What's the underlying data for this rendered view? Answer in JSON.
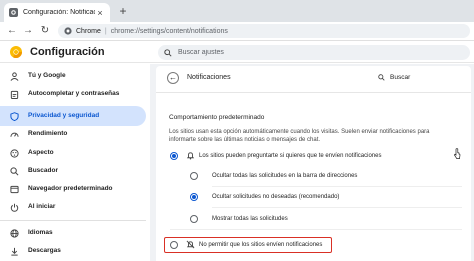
{
  "tab": {
    "title": "Configuración: Notificaciones",
    "close": "×",
    "new": "+"
  },
  "toolbar": {
    "back": "←",
    "forward": "→",
    "reload": "↻",
    "omnibox": {
      "scheme": "Chrome",
      "sep": "|",
      "path": "chrome://settings/content/notifications"
    }
  },
  "header": {
    "title": "Configuración",
    "search_placeholder": "Buscar ajustes"
  },
  "sidebar": {
    "items": [
      {
        "label": "Tú y Google",
        "icon": "person-icon",
        "active": false
      },
      {
        "label": "Autocompletar y contraseñas",
        "icon": "clipboard-icon",
        "active": false
      },
      {
        "label": "Privacidad y seguridad",
        "icon": "shield-icon",
        "active": true
      },
      {
        "label": "Rendimiento",
        "icon": "speedometer-icon",
        "active": false
      },
      {
        "label": "Aspecto",
        "icon": "palette-icon",
        "active": false
      },
      {
        "label": "Buscador",
        "icon": "search-icon",
        "active": false
      },
      {
        "label": "Navegador predeterminado",
        "icon": "browser-icon",
        "active": false
      },
      {
        "label": "Al iniciar",
        "icon": "power-icon",
        "active": false
      },
      {
        "label": "Idiomas",
        "icon": "globe-icon",
        "active": false
      },
      {
        "label": "Descargas",
        "icon": "download-icon",
        "active": false
      }
    ]
  },
  "panel": {
    "back": "←",
    "title": "Notificaciones",
    "search_label": "Buscar",
    "section_title": "Comportamiento predeterminado",
    "description": "Los sitios usan esta opción automáticamente cuando los visitas. Suelen enviar notificaciones para informarte sobre las últimas noticias o mensajes de chat.",
    "options": {
      "allow": "Los sitios pueden preguntarte si quieres que te envíen notificaciones",
      "quieter": "Ocultar todas las solicitudes en la barra de direcciones",
      "recommended": "Ocultar solicitudes no deseadas (recomendado)",
      "show_all": "Mostrar todas las solicitudes",
      "block": "No permitir que los sitios envíen notificaciones"
    }
  },
  "colors": {
    "accent": "#0b57d0",
    "active_bg": "#d3e3fd",
    "highlight": "#d93025"
  }
}
